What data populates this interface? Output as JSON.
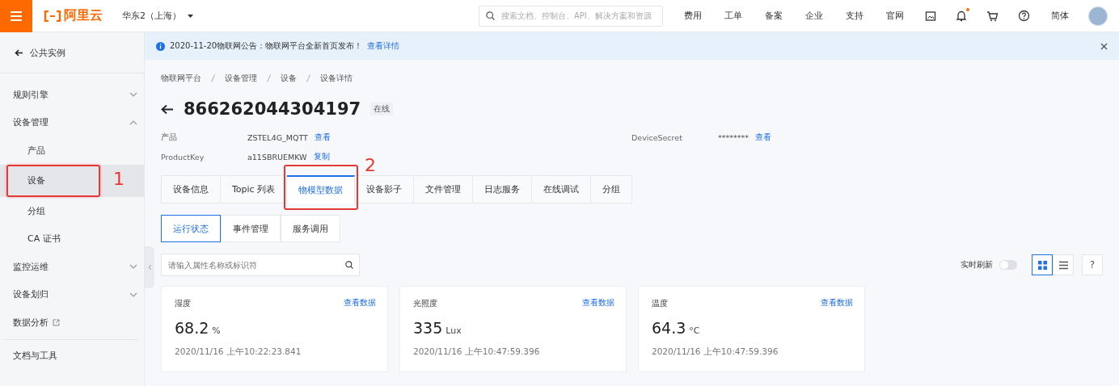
{
  "topbar": {
    "logo": "阿里云",
    "region": "华东2（上海）",
    "search": {
      "placeholder": "搜索文档、控制台、API、解决方案和资源"
    },
    "nav": [
      "费用",
      "工单",
      "备案",
      "企业",
      "支持",
      "官网"
    ],
    "icons": [
      {
        "kind": "screen",
        "badge": false
      },
      {
        "kind": "bell",
        "badge": true
      },
      {
        "kind": "cart",
        "badge": false
      },
      {
        "kind": "help",
        "badge": false
      }
    ],
    "language": "简体"
  },
  "sidebar": {
    "back": "公共实例",
    "items": [
      {
        "label": "规则引擎",
        "kind": "group",
        "expanded": false,
        "selected": false
      },
      {
        "label": "设备管理",
        "kind": "group",
        "expanded": true,
        "selected": false,
        "children": [
          {
            "label": "产品",
            "selected": false
          },
          {
            "label": "设备",
            "selected": true,
            "callout": "1"
          },
          {
            "label": "分组",
            "selected": false
          },
          {
            "label": "CA 证书",
            "selected": false
          }
        ]
      },
      {
        "label": "监控运维",
        "kind": "group",
        "expanded": false,
        "selected": false
      },
      {
        "label": "设备划归",
        "kind": "group",
        "expanded": false,
        "selected": false
      },
      {
        "label": "数据分析",
        "kind": "external",
        "selected": false
      }
    ],
    "footer": "文档与工具"
  },
  "notice": {
    "text": "2020-11-20物联网公告：物联网平台全新首页发布！",
    "link": "查看详情"
  },
  "breadcrumb": [
    "物联网平台",
    "设备管理",
    "设备",
    "设备详情"
  ],
  "device": {
    "name": "866262044304197",
    "status": "在线"
  },
  "info": [
    {
      "label": "产品",
      "value": "ZSTEL4G_MQTT",
      "action": "查看"
    },
    {
      "label": "DeviceSecret",
      "value": "********",
      "action": "查看"
    },
    {
      "label": "ProductKey",
      "value": "a11SBRUEMKW",
      "action": "复制"
    }
  ],
  "tabs": [
    {
      "label": "设备信息",
      "selected": false
    },
    {
      "label": "Topic 列表",
      "selected": false
    },
    {
      "label": "物模型数据",
      "selected": true,
      "callout": "2"
    },
    {
      "label": "设备影子",
      "selected": false
    },
    {
      "label": "文件管理",
      "selected": false
    },
    {
      "label": "日志服务",
      "selected": false
    },
    {
      "label": "在线调试",
      "selected": false
    },
    {
      "label": "分组",
      "selected": false
    }
  ],
  "subtabs": [
    {
      "label": "运行状态",
      "selected": true
    },
    {
      "label": "事件管理",
      "selected": false
    },
    {
      "label": "服务调用",
      "selected": false
    }
  ],
  "filter": {
    "placeholder": "请输入属性名称或标识符"
  },
  "refresh": {
    "label": "实时刷新",
    "on": false
  },
  "views": [
    {
      "kind": "grid",
      "selected": true
    },
    {
      "kind": "list",
      "selected": false
    }
  ],
  "help": "?",
  "cards": [
    {
      "name": "湿度",
      "link": "查看数据",
      "value": "68.2",
      "unit": "%",
      "time": "2020/11/16 上午10:22:23.841"
    },
    {
      "name": "光照度",
      "link": "查看数据",
      "value": "335",
      "unit": "Lux",
      "time": "2020/11/16 上午10:47:59.396"
    },
    {
      "name": "温度",
      "link": "查看数据",
      "value": "64.3",
      "unit": "°C",
      "time": "2020/11/16 上午10:47:59.396"
    }
  ]
}
